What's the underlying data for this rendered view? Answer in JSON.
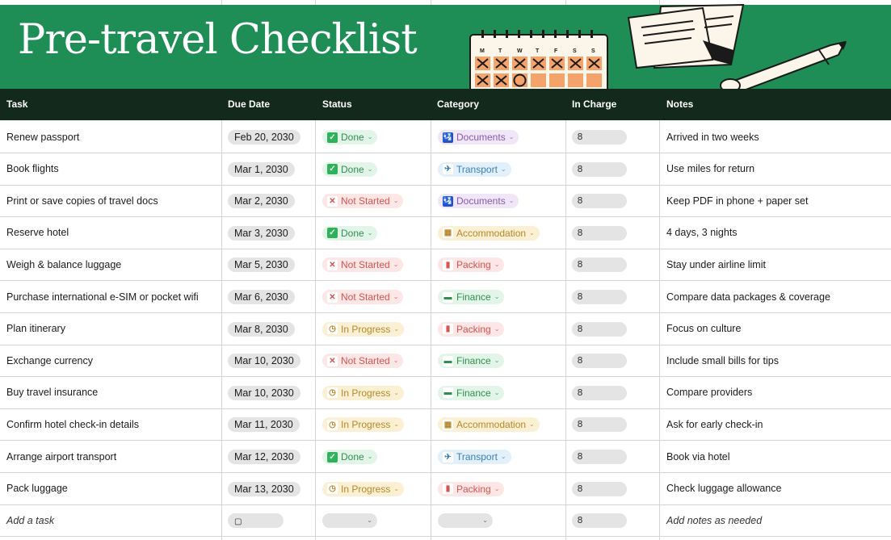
{
  "banner": {
    "title": "Pre-travel Checklist",
    "background": "#1f8e56"
  },
  "calendar": {
    "day_letters": [
      "M",
      "T",
      "W",
      "T",
      "F",
      "S",
      "S"
    ]
  },
  "columns": {
    "task": "Task",
    "due_date": "Due Date",
    "status": "Status",
    "category": "Category",
    "in_charge": "In Charge",
    "notes": "Notes"
  },
  "status_styles": {
    "Done": {
      "bg": "#e3f5e9",
      "color": "#2f8f4e",
      "icon": "check-icon",
      "glyph": "✓",
      "icon_bg": "#2fb35a"
    },
    "Not Started": {
      "bg": "#fde6e6",
      "color": "#d9534f",
      "icon": "x-icon",
      "glyph": "✕",
      "icon_bg": "#ffffff"
    },
    "In Progress": {
      "bg": "#fbf0d4",
      "color": "#b8872a",
      "icon": "clock-icon",
      "glyph": "◷",
      "icon_bg": "#ffffff"
    }
  },
  "category_styles": {
    "Documents": {
      "bg": "#efe6f7",
      "color": "#8a5aa9",
      "icon": "passport-icon",
      "glyph": "🛂",
      "icon_bg": "#2b4fd1"
    },
    "Transport": {
      "bg": "#e2f0fb",
      "color": "#3d7fb5",
      "icon": "airplane-icon",
      "glyph": "✈",
      "icon_bg": "#ffffff"
    },
    "Accommodation": {
      "bg": "#fbf0d4",
      "color": "#b8872a",
      "icon": "hotel-icon",
      "glyph": "▦",
      "icon_bg": "#ffffff"
    },
    "Packing": {
      "bg": "#fde6e6",
      "color": "#d9534f",
      "icon": "luggage-icon",
      "glyph": "▮",
      "icon_bg": "#ffffff"
    },
    "Finance": {
      "bg": "#e3f5e9",
      "color": "#2f8f4e",
      "icon": "credit-card-icon",
      "glyph": "▬",
      "icon_bg": "#ffffff"
    }
  },
  "rows": [
    {
      "task": "Renew passport",
      "due": "Feb 20, 2030",
      "status": "Done",
      "category": "Documents",
      "notes": "Arrived in two weeks"
    },
    {
      "task": "Book flights",
      "due": "Mar 1, 2030",
      "status": "Done",
      "category": "Transport",
      "notes": "Use miles for return"
    },
    {
      "task": "Print or save copies of travel docs",
      "due": "Mar 2, 2030",
      "status": "Not Started",
      "category": "Documents",
      "notes": "Keep PDF in phone + paper set"
    },
    {
      "task": "Reserve hotel",
      "due": "Mar 3, 2030",
      "status": "Done",
      "category": "Accommodation",
      "notes": "4 days, 3 nights"
    },
    {
      "task": "Weigh & balance luggage",
      "due": "Mar 5, 2030",
      "status": "Not Started",
      "category": "Packing",
      "notes": "Stay under airline limit"
    },
    {
      "task": "Purchase international e-SIM or pocket wifi",
      "due": "Mar 6, 2030",
      "status": "Not Started",
      "category": "Finance",
      "notes": "Compare data packages & coverage"
    },
    {
      "task": "Plan itinerary",
      "due": "Mar 8, 2030",
      "status": "In Progress",
      "category": "Packing",
      "notes": "Focus on culture"
    },
    {
      "task": "Exchange currency",
      "due": "Mar 10, 2030",
      "status": "Not Started",
      "category": "Finance",
      "notes": "Include small bills for tips"
    },
    {
      "task": "Buy travel insurance",
      "due": "Mar 10, 2030",
      "status": "In Progress",
      "category": "Finance",
      "notes": "Compare providers"
    },
    {
      "task": "Confirm hotel check-in details",
      "due": "Mar 11, 2030",
      "status": "In Progress",
      "category": "Accommodation",
      "notes": "Ask for early check-in"
    },
    {
      "task": "Arrange airport transport",
      "due": "Mar 12, 2030",
      "status": "Done",
      "category": "Transport",
      "notes": "Book via hotel"
    },
    {
      "task": "Pack luggage",
      "due": "Mar 13, 2030",
      "status": "In Progress",
      "category": "Packing",
      "notes": "Check luggage allowance"
    }
  ],
  "add_row": {
    "task_placeholder": "Add a task",
    "notes_placeholder": "Add notes as needed"
  }
}
